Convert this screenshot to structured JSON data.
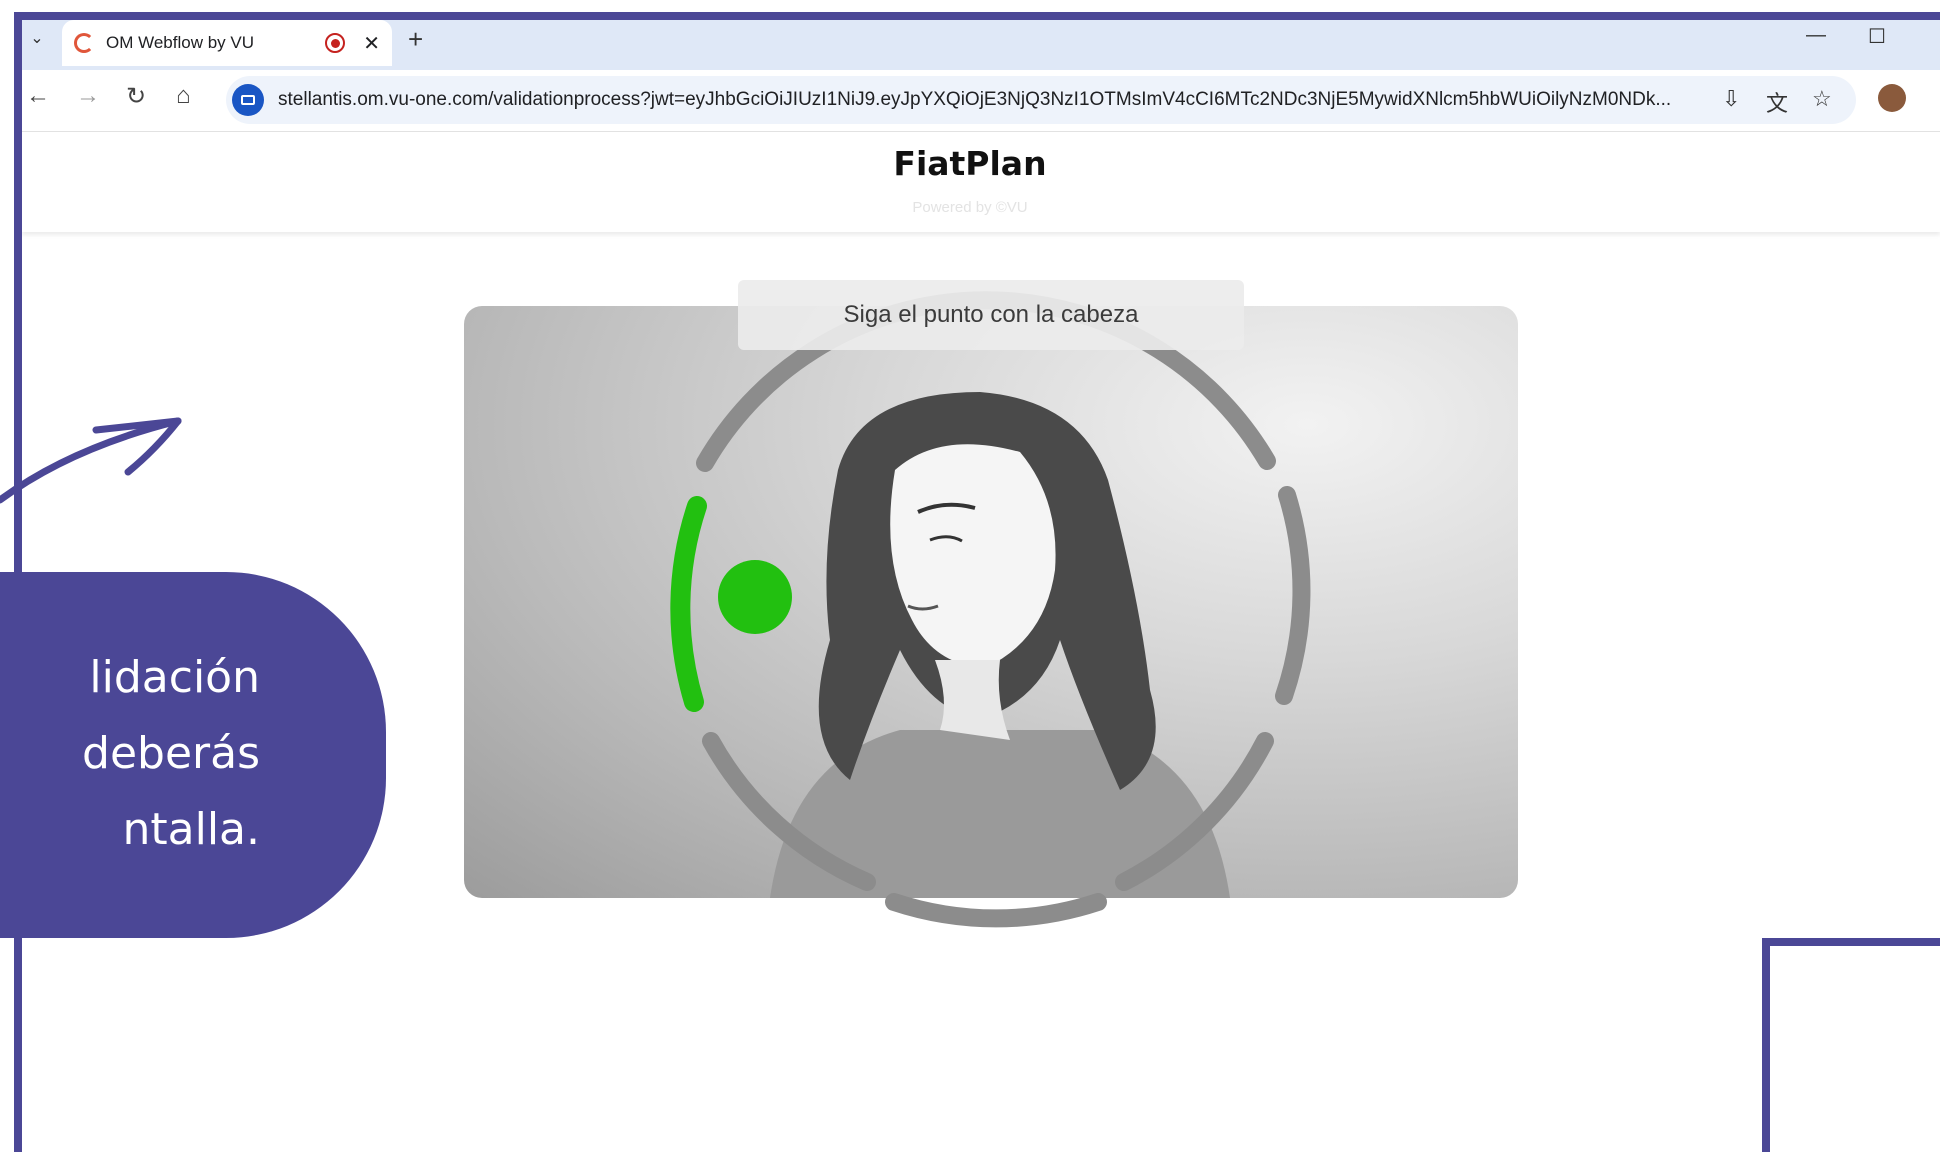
{
  "browser": {
    "tab_title": "OM Webflow by VU",
    "url": "stellantis.om.vu-one.com/validationprocess?jwt=eyJhbGciOiJIUzI1NiJ9.eyJpYXQiOjE3NjQ3NzI1OTMsImV4cCI6MTc2NDc3NjE5MywidXNlcm5hbWUiOilyNzM0NDk..."
  },
  "page": {
    "brand": "FiatPlan",
    "powered_by": "Powered by ©VU"
  },
  "capture": {
    "instruction": "Siga el punto con la cabeza",
    "progress_color": "#22c010",
    "ring_color": "#8c8c8c"
  },
  "tutorial": {
    "bubble_text_lines": [
      "lidación",
      "deberás",
      "ntalla."
    ],
    "accent_color": "#4b4796"
  }
}
